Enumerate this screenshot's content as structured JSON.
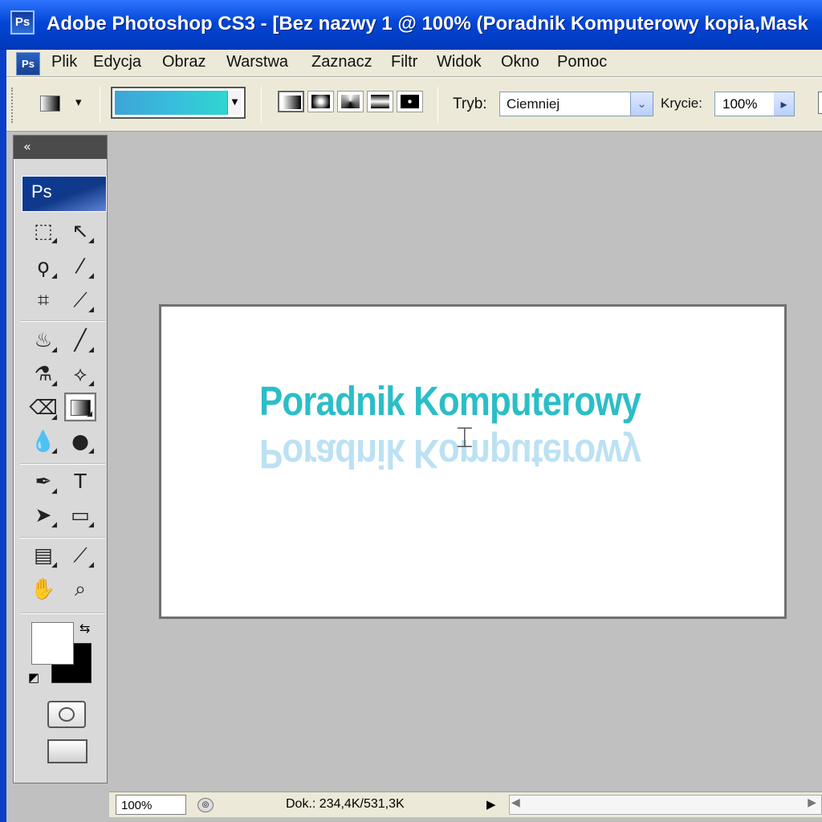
{
  "window": {
    "title": "Adobe Photoshop CS3 - [Bez nazwy 1 @ 100% (Poradnik Komputerowy  kopia,Mask",
    "app_icon": "Ps"
  },
  "menu": {
    "doc_icon": "Ps",
    "items": [
      "Plik",
      "Edycja",
      "Obraz",
      "Warstwa",
      "Zaznacz",
      "Filtr",
      "Widok",
      "Okno",
      "Pomoc"
    ]
  },
  "options": {
    "gradient_colors": [
      "#3da5d6",
      "#2fd6cf"
    ],
    "gradient_types": [
      "linear-gradient",
      "radial-gradient",
      "angle-gradient",
      "reflected-gradient",
      "diamond-gradient"
    ],
    "mode_label": "Tryb:",
    "mode_value": "Ciemniej",
    "opacity_label": "Krycie:",
    "opacity_value": "100%"
  },
  "toolbox": {
    "logo": "Ps",
    "tools": [
      "rectangular-marquee",
      "move",
      "lasso",
      "magic-wand",
      "crop",
      "slice",
      "healing-brush",
      "brush",
      "clone-stamp",
      "history-brush",
      "eraser",
      "gradient",
      "blur",
      "dodge",
      "pen",
      "type",
      "path-selection",
      "rectangle",
      "notes",
      "eyedropper",
      "hand",
      "zoom"
    ],
    "type_label": "T",
    "foreground_color": "#ffffff",
    "background_color": "#000000"
  },
  "document": {
    "text": "Poradnik Komputerowy",
    "text_color": "#2bbec7",
    "reflection_color": "#b9e0f3"
  },
  "status": {
    "zoom": "100%",
    "doc_size": "Dok.: 234,4K/531,3K"
  }
}
